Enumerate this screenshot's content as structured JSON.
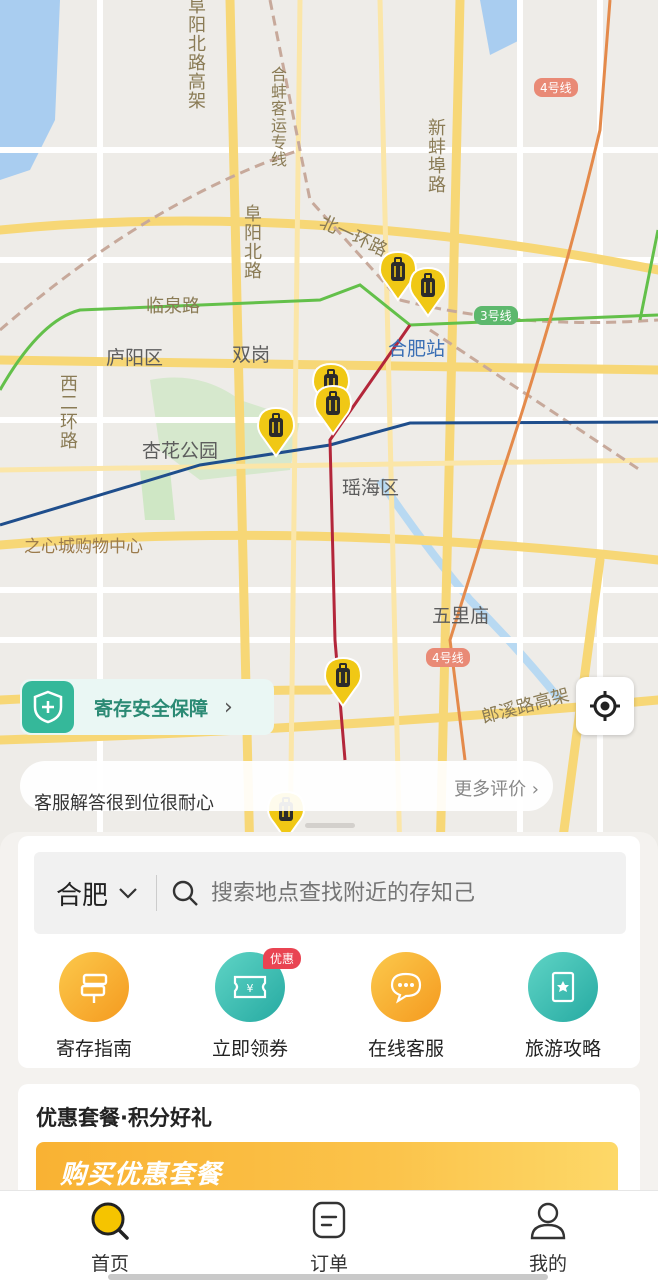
{
  "map": {
    "labels": {
      "fuyang_north_elevated": "阜阳北路高架",
      "hebeng_line": "合蚌客运专线",
      "xinbeng_road": "新蚌埠路",
      "north_ring": "北一环路",
      "fuyang_north_road": "阜阳北路",
      "linquan_road": "临泉路",
      "luyang_district": "庐阳区",
      "shuanggang": "双岗",
      "hefei_station": "合肥站",
      "west_ring": "西二环路",
      "xinghua_park": "杏花公园",
      "yaohai_district": "瑶海区",
      "zhixin_mall": "之心城购物中心",
      "wulimiao": "五里庙",
      "langxi_elevated": "郎溪路高架"
    },
    "metro_badges": [
      "4号线",
      "3号线",
      "4号线"
    ]
  },
  "safety_banner": {
    "label": "寄存安全保障"
  },
  "review": {
    "quote": "客服解答很到位很耐心",
    "more_label": "更多评价 ›"
  },
  "search": {
    "city": "合肥",
    "placeholder": "搜索地点查找附近的存知己"
  },
  "quick_actions": [
    {
      "label": "寄存指南",
      "icon": "signpost-icon"
    },
    {
      "label": "立即领券",
      "icon": "coupon-icon",
      "badge": "优惠"
    },
    {
      "label": "在线客服",
      "icon": "chat-icon"
    },
    {
      "label": "旅游攻略",
      "icon": "guidebook-icon"
    }
  ],
  "promo": {
    "title": "优惠套餐·积分好礼",
    "banner_text": "购买优惠套餐"
  },
  "tabs": [
    {
      "label": "首页",
      "icon": "search-icon",
      "active": true
    },
    {
      "label": "订单",
      "icon": "order-icon",
      "active": false
    },
    {
      "label": "我的",
      "icon": "profile-icon",
      "active": false
    }
  ],
  "colors": {
    "accent": "#f5c400",
    "teal": "#35b89a",
    "orange": "#f7a823"
  }
}
